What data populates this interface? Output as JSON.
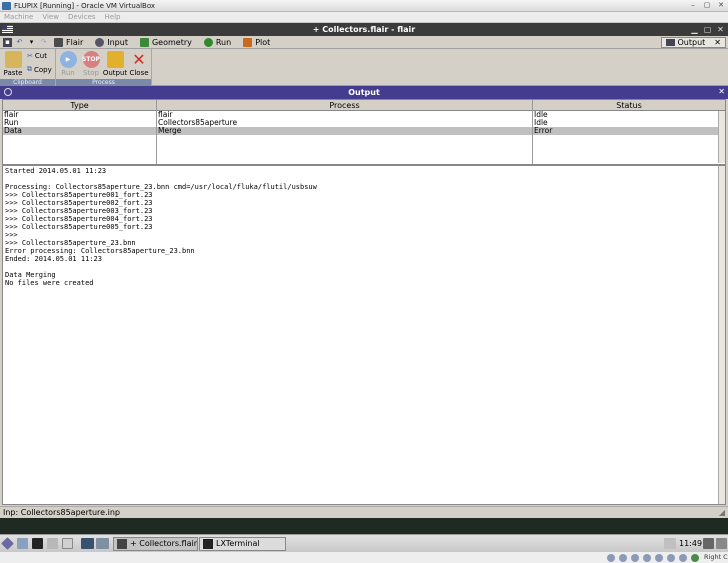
{
  "vbox": {
    "title": "FLUPIX [Running] - Oracle VM VirtualBox",
    "menus": [
      "Machine",
      "View",
      "Devices",
      "Help"
    ],
    "host_key": "Right Ctrl"
  },
  "flair": {
    "title": "+ Collectors.flair - flair",
    "tabs": [
      "Flair",
      "Input",
      "Geometry",
      "Run",
      "Plot"
    ],
    "right_tab": "Output"
  },
  "ribbon": {
    "paste": "Paste",
    "cut": "Cut",
    "copy": "Copy",
    "clipboard_group": "Clipboard",
    "run": "Run",
    "stop": "Stop",
    "output": "Output",
    "close": "Close",
    "process_group": "Process"
  },
  "output_panel": {
    "title": "Output",
    "columns": [
      "Type",
      "Process",
      "Status"
    ],
    "rows": [
      {
        "type": "flair",
        "process": "flair",
        "status": "Idle"
      },
      {
        "type": "Run",
        "process": "Collectors85aperture",
        "status": "Idle"
      },
      {
        "type": "Data",
        "process": "Merge",
        "status": "Error"
      }
    ]
  },
  "log": {
    "text": "Started 2014.05.01 11:23\n\nProcessing: Collectors85aperture_23.bnn cmd=/usr/local/fluka/flutil/usbsuw\n>>> Collectors85aperture001_fort.23\n>>> Collectors85aperture002_fort.23\n>>> Collectors85aperture003_fort.23\n>>> Collectors85aperture004_fort.23\n>>> Collectors85aperture005_fort.23\n>>>\n>>> Collectors85aperture_23.bnn\nError processing: Collectors85aperture_23.bnn\nEnded: 2014.05.01 11:23\n\nData Merging\nNo files were created"
  },
  "statusbar": {
    "text": "Inp: Collectors85aperture.inp"
  },
  "taskbar": {
    "tasks": [
      "+ Collectors.flair - ...",
      "LXTerminal"
    ],
    "clock": "11:49"
  }
}
